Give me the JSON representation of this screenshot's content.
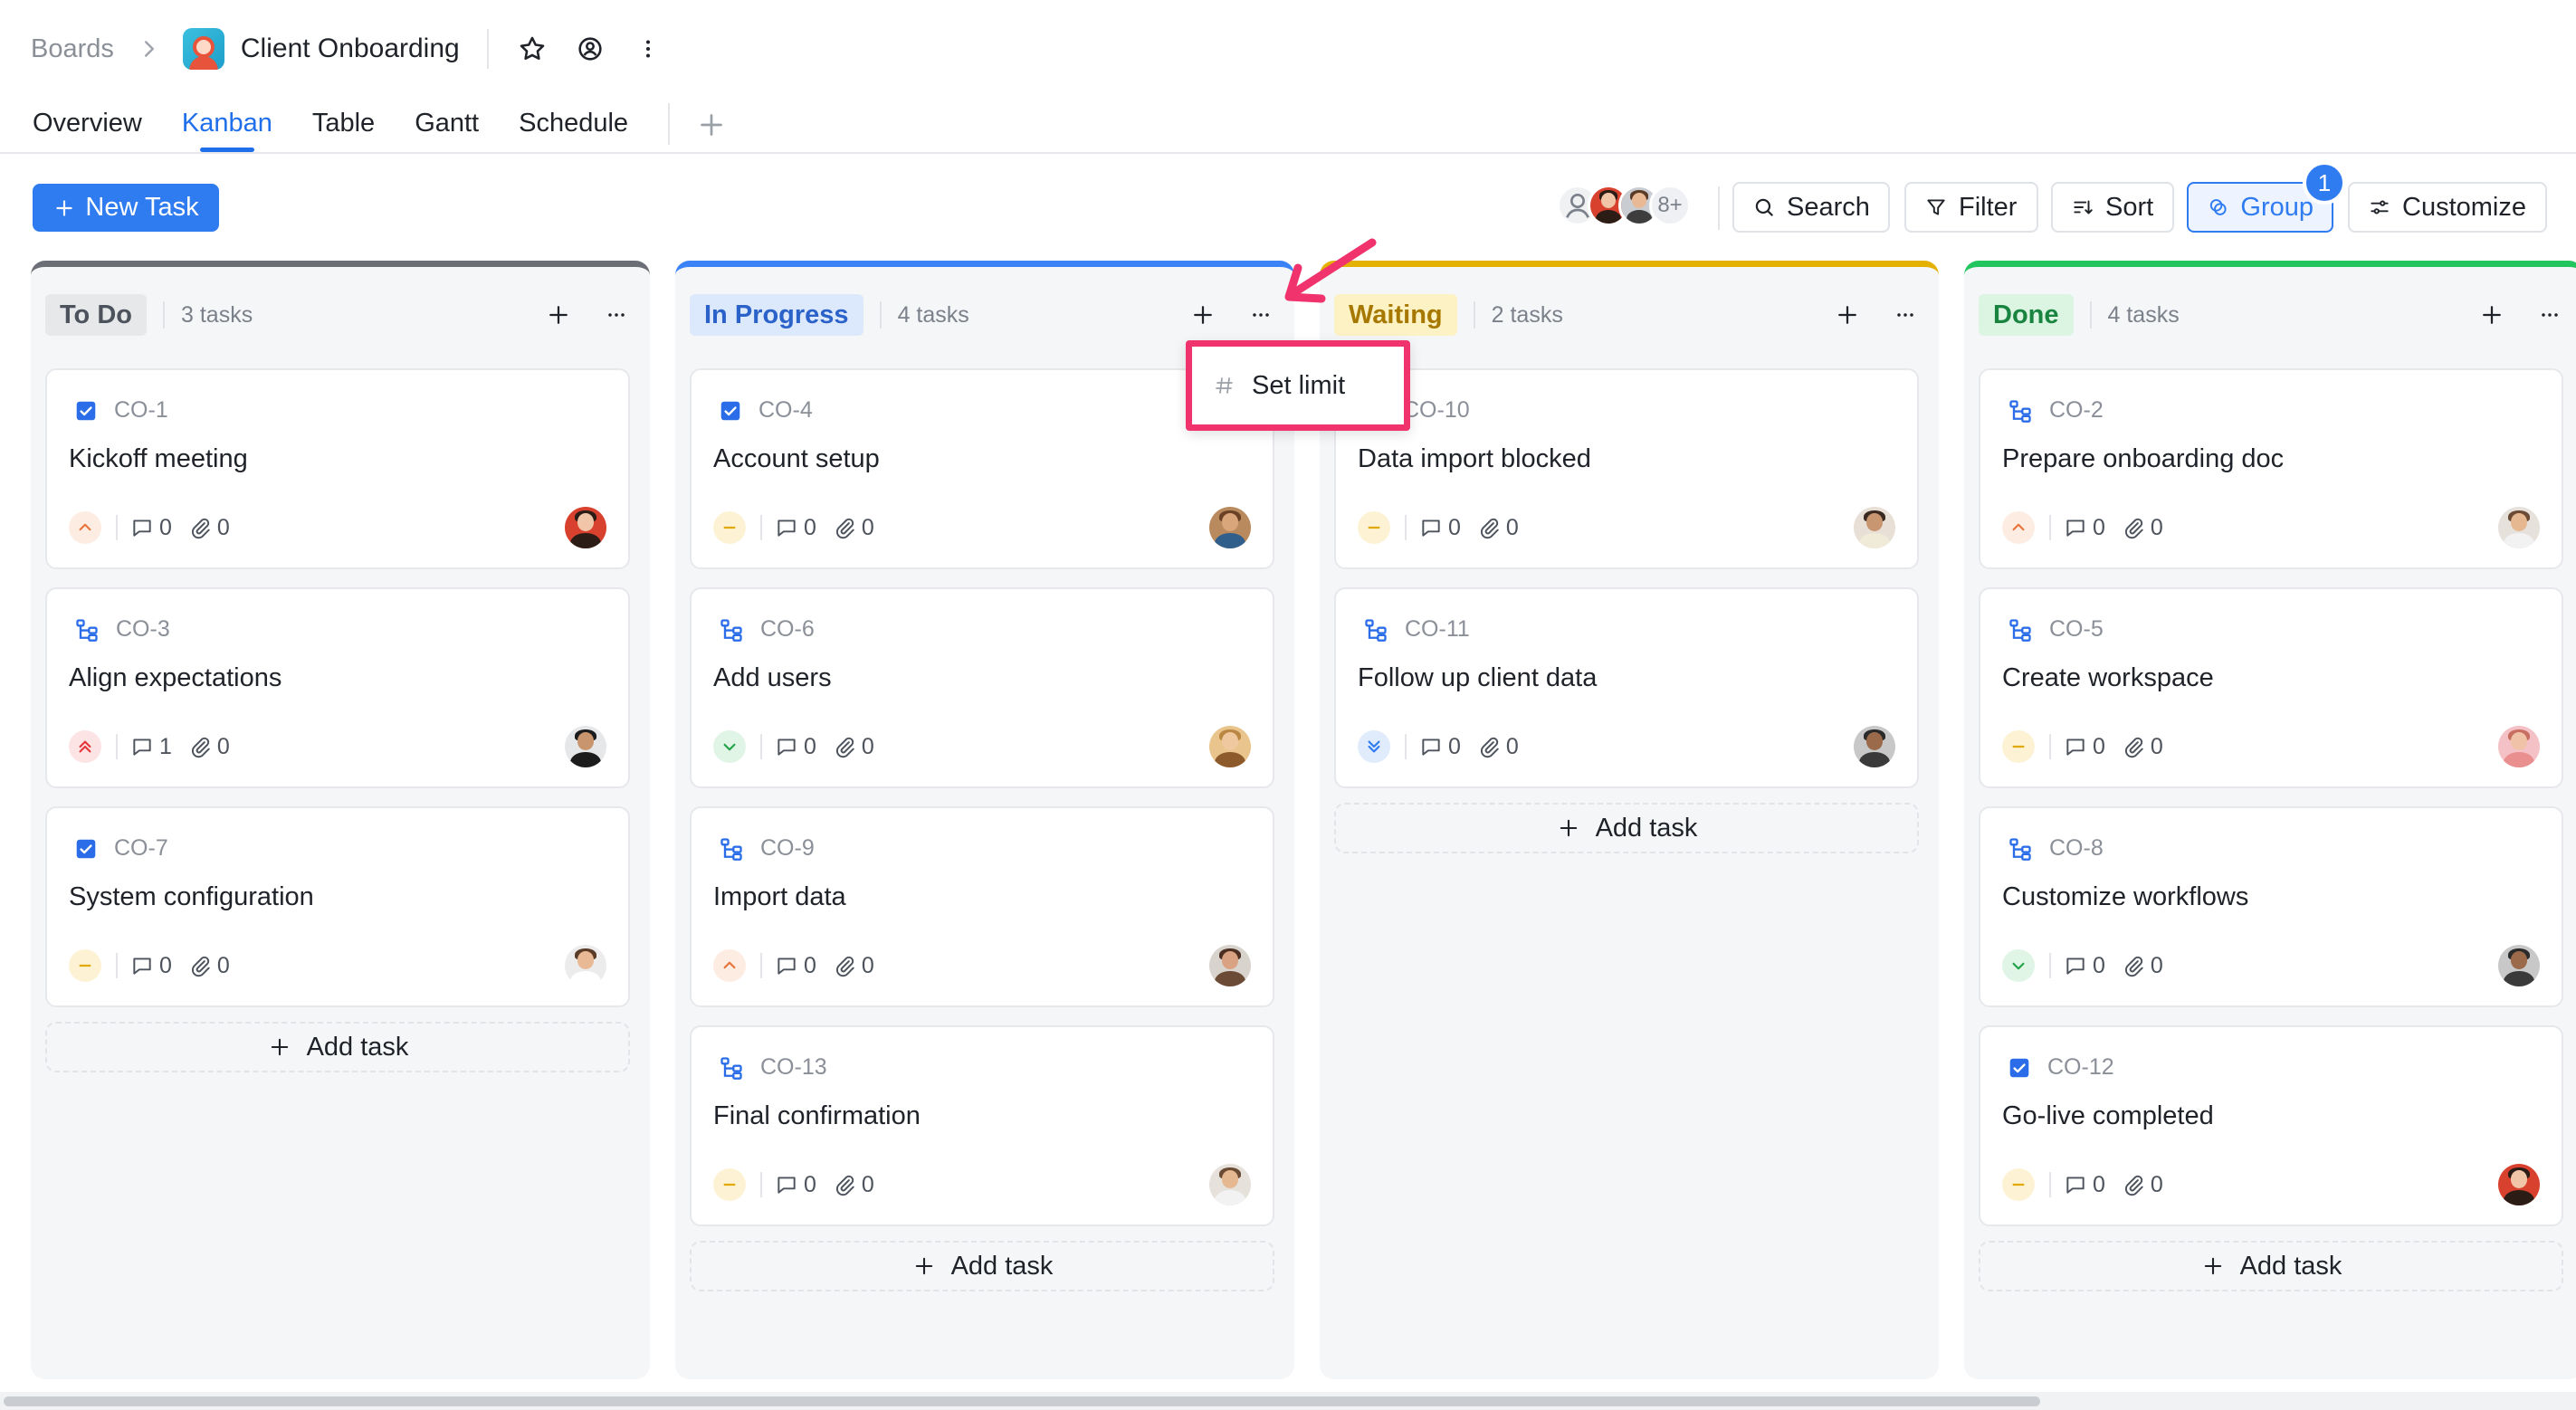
{
  "header": {
    "breadcrumb_root": "Boards",
    "board_title": "Client Onboarding"
  },
  "tabs": [
    {
      "label": "Overview",
      "active": false
    },
    {
      "label": "Kanban",
      "active": true
    },
    {
      "label": "Table",
      "active": false
    },
    {
      "label": "Gantt",
      "active": false
    },
    {
      "label": "Schedule",
      "active": false
    }
  ],
  "toolbar": {
    "new_task_label": "New Task",
    "members_more": "8+",
    "search_label": "Search",
    "filter_label": "Filter",
    "sort_label": "Sort",
    "group_label": "Group",
    "group_badge": "1",
    "customize_label": "Customize"
  },
  "menu": {
    "set_limit_label": "Set limit"
  },
  "add_task_label": "Add task",
  "colors": {
    "accent": "#2f7bf0",
    "highlight": "#f0326d",
    "todo": "#6b6f75",
    "in_progress": "#3b82f6",
    "waiting": "#e4b100",
    "done": "#22c55e"
  },
  "columns": [
    {
      "name": "To Do",
      "count": "3 tasks",
      "cards": [
        {
          "id": "CO-1",
          "title": "Kickoff meeting",
          "type": "check",
          "priority": "high",
          "comments": "0",
          "attachments": "0",
          "avatar": "woman-red"
        },
        {
          "id": "CO-3",
          "title": "Align expectations",
          "type": "subtask",
          "priority": "urgent",
          "comments": "1",
          "attachments": "0",
          "avatar": "woman-dark"
        },
        {
          "id": "CO-7",
          "title": "System configuration",
          "type": "check",
          "priority": "medium",
          "comments": "0",
          "attachments": "0",
          "avatar": "man-light"
        }
      ]
    },
    {
      "name": "In Progress",
      "count": "4 tasks",
      "cards": [
        {
          "id": "CO-4",
          "title": "Account setup",
          "type": "check",
          "priority": "medium",
          "comments": "0",
          "attachments": "0",
          "avatar": "woman-curly"
        },
        {
          "id": "CO-6",
          "title": "Add users",
          "type": "subtask",
          "priority": "low",
          "comments": "0",
          "attachments": "0",
          "avatar": "woman-blonde"
        },
        {
          "id": "CO-9",
          "title": "Import data",
          "type": "subtask",
          "priority": "high",
          "comments": "0",
          "attachments": "0",
          "avatar": "woman-brown"
        },
        {
          "id": "CO-13",
          "title": "Final confirmation",
          "type": "subtask",
          "priority": "medium",
          "comments": "0",
          "attachments": "0",
          "avatar": "man-beard"
        }
      ]
    },
    {
      "name": "Waiting",
      "count": "2 tasks",
      "cards": [
        {
          "id": "CO-10",
          "title": "Data import blocked",
          "type": "check",
          "priority": "medium",
          "comments": "0",
          "attachments": "0",
          "avatar": "man-tan"
        },
        {
          "id": "CO-11",
          "title": "Follow up client data",
          "type": "subtask",
          "priority": "lowest",
          "comments": "0",
          "attachments": "0",
          "avatar": "man-dark"
        }
      ]
    },
    {
      "name": "Done",
      "count": "4 tasks",
      "cards": [
        {
          "id": "CO-2",
          "title": "Prepare onboarding doc",
          "type": "subtask",
          "priority": "high",
          "comments": "0",
          "attachments": "0",
          "avatar": "man-beard"
        },
        {
          "id": "CO-5",
          "title": "Create workspace",
          "type": "subtask",
          "priority": "medium",
          "comments": "0",
          "attachments": "0",
          "avatar": "woman-pink"
        },
        {
          "id": "CO-8",
          "title": "Customize workflows",
          "type": "subtask",
          "priority": "low",
          "comments": "0",
          "attachments": "0",
          "avatar": "man-dark"
        },
        {
          "id": "CO-12",
          "title": "Go-live completed",
          "type": "check",
          "priority": "medium",
          "comments": "0",
          "attachments": "0",
          "avatar": "woman-red"
        }
      ]
    }
  ]
}
